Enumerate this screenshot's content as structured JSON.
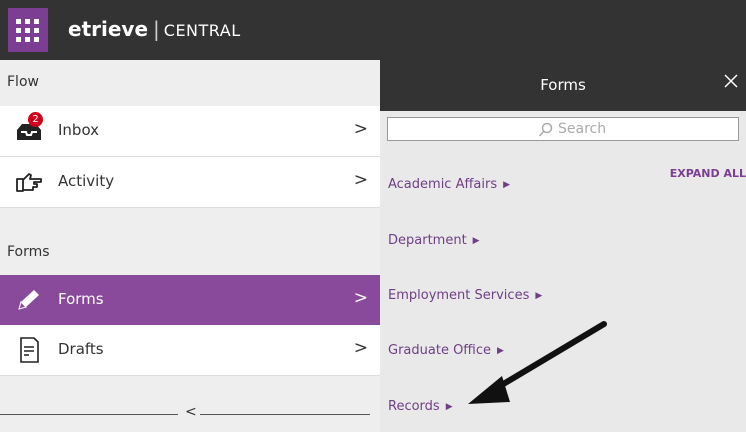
{
  "app": {
    "brand_name": "etrieve",
    "brand_sub": "CENTRAL"
  },
  "sidebar": {
    "flow_header": "Flow",
    "forms_header": "Forms",
    "items": [
      {
        "label": "Inbox",
        "badge": "2"
      },
      {
        "label": "Activity"
      },
      {
        "label": "Forms",
        "active": true
      },
      {
        "label": "Drafts"
      }
    ],
    "collapse_glyph": "<"
  },
  "panel": {
    "title": "Forms",
    "search_placeholder": "Search",
    "expand_all": "EXPAND ALL",
    "categories": [
      "Academic Affairs",
      "Department",
      "Employment Services",
      "Graduate Office",
      "Records"
    ]
  },
  "colors": {
    "topbar": "#333333",
    "accent_purple": "#8a4a9b",
    "link_purple": "#6f3f86",
    "badge_red": "#d0021b"
  }
}
